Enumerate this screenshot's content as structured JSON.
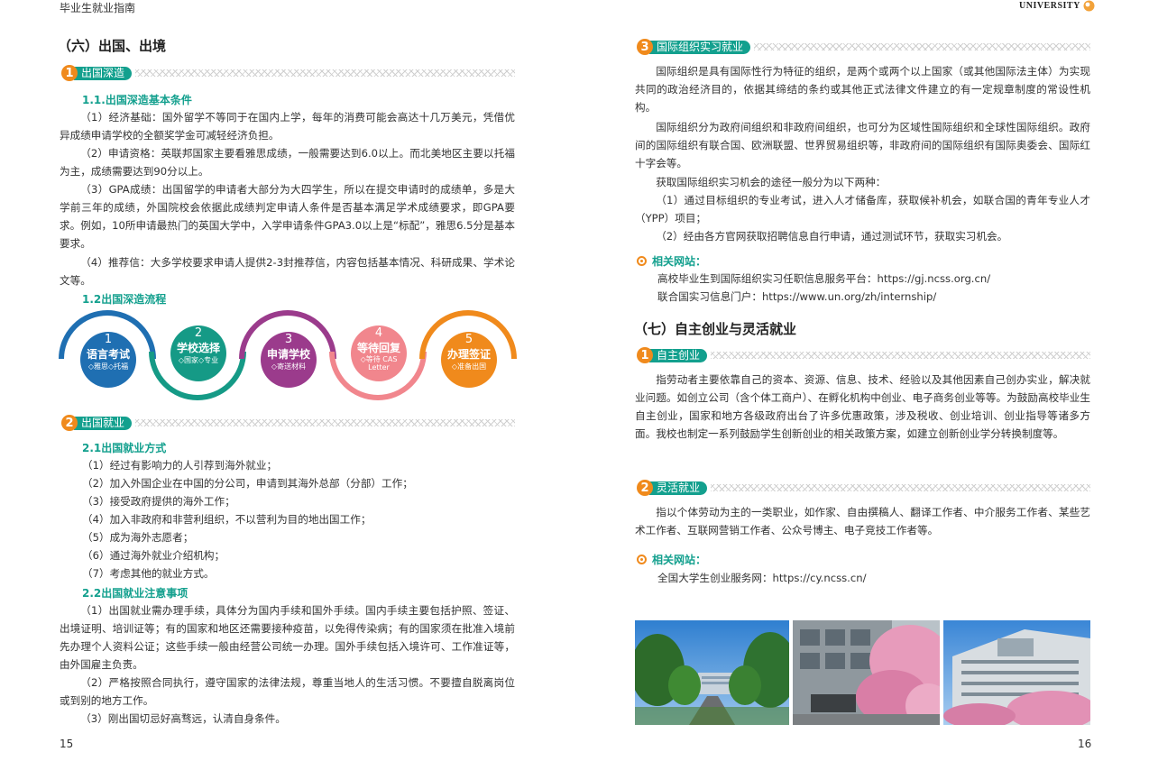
{
  "header": {
    "left_title": "毕业生就业指南",
    "right_brand": "UNIVERSITY"
  },
  "left": {
    "section_title": "（六）出国、出境",
    "badge1": {
      "num": "1",
      "label": "出国深造"
    },
    "sub_1_1": "1.1.出国深造基本条件",
    "p1": "（1）经济基础：国外留学不等同于在国内上学，每年的消费可能会高达十几万美元，凭借优异成绩申请学校的全额奖学金可减轻经济负担。",
    "p2": "（2）申请资格：英联邦国家主要看雅思成绩，一般需要达到6.0以上。而北美地区主要以托福为主，成绩需要达到90分以上。",
    "p3": "（3）GPA成绩：出国留学的申请者大部分为大四学生，所以在提交申请时的成绩单，多是大学前三年的成绩，外国院校会依据此成绩判定申请人条件是否基本满足学术成绩要求，即GPA要求。例如，10所申请最热门的英国大学中，入学申请条件GPA3.0以上是“标配”，雅思6.5分是基本要求。",
    "p4": "（4）推荐信：大多学校要求申请人提供2-3封推荐信，内容包括基本情况、科研成果、学术论文等。",
    "sub_1_2": "1.2出国深造流程",
    "steps": [
      {
        "num": "1",
        "title": "语言考试",
        "desc": "◇雅思◇托福",
        "color": "#1f6fb2"
      },
      {
        "num": "2",
        "title": "学校选择",
        "desc": "◇国家◇专业",
        "color": "#159a86"
      },
      {
        "num": "3",
        "title": "申请学校",
        "desc": "◇寄送材料",
        "color": "#9b3b8c"
      },
      {
        "num": "4",
        "title": "等待回复",
        "desc": "◇等待 CAS Letter",
        "color": "#f1868d"
      },
      {
        "num": "5",
        "title": "办理签证",
        "desc": "◇准备出国",
        "color": "#f08a1c"
      }
    ],
    "badge2": {
      "num": "2",
      "label": "出国就业"
    },
    "sub_2_1": "2.1出国就业方式",
    "ways": [
      "（1）经过有影响力的人引荐到海外就业；",
      "（2）加入外国企业在中国的分公司，申请到其海外总部（分部）工作；",
      "（3）接受政府提供的海外工作；",
      "（4）加入非政府和非营利组织，不以营利为目的地出国工作；",
      "（5）成为海外志愿者；",
      "（6）通过海外就业介绍机构；",
      "（7）考虑其他的就业方式。"
    ],
    "sub_2_2": "2.2出国就业注意事项",
    "n1": "（1）出国就业需办理手续，具体分为国内手续和国外手续。国内手续主要包括护照、签证、出境证明、培训证等；有的国家和地区还需要接种疫苗，以免得传染病；有的国家须在批准入境前先办理个人资料公证；这些手续一般由经营公司统一办理。国外手续包括入境许可、工作准证等，由外国雇主负责。",
    "n2": "（2）严格按照合同执行，遵守国家的法律法规，尊重当地人的生活习惯。不要擅自脱离岗位或到别的地方工作。",
    "n3": "（3）刚出国切忌好高骛远，认清自身条件。",
    "page_num": "15"
  },
  "right": {
    "badge3": {
      "num": "3",
      "label": "国际组织实习就业"
    },
    "r1": "国际组织是具有国际性行为特征的组织，是两个或两个以上国家（或其他国际法主体）为实现共同的政治经济目的，依据其缔结的条约或其他正式法律文件建立的有一定规章制度的常设性机构。",
    "r2": "国际组织分为政府间组织和非政府间组织，也可分为区域性国际组织和全球性国际组织。政府间的国际组织有联合国、欧洲联盟、世界贸易组织等，非政府间的国际组织有国际奥委会、国际红十字会等。",
    "r3": "获取国际组织实习机会的途径一般分为以下两种：",
    "r4": "（1）通过目标组织的专业考试，进入人才储备库，获取候补机会，如联合国的青年专业人才（YPP）项目；",
    "r5": "（2）经由各方官网获取招聘信息自行申请，通过测试环节，获取实习机会。",
    "site_label": "相关网站：",
    "site1": "高校毕业生到国际组织实习任职信息服务平台：https://gj.ncss.org.cn/",
    "site2": "联合国实习信息门户：https://www.un.org/zh/internship/",
    "section_title": "（七）自主创业与灵活就业",
    "badge4": {
      "num": "1",
      "label": "自主创业"
    },
    "e1": "指劳动者主要依靠自己的资本、资源、信息、技术、经验以及其他因素自己创办实业，解决就业问题。如创立公司（含个体工商户）、在孵化机构中创业、电子商务创业等等。为鼓励高校毕业生自主创业，国家和地方各级政府出台了许多优惠政策，涉及税收、创业培训、创业指导等诸多方面。我校也制定一系列鼓励学生创新创业的相关政策方案，如建立创新创业学分转换制度等。",
    "badge5": {
      "num": "2",
      "label": "灵活就业"
    },
    "f1": "指以个体劳动为主的一类职业，如作家、自由撰稿人、翻译工作者、中介服务工作者、某些艺术工作者、互联网营销工作者、公众号博主、电子竞技工作者等。",
    "site3": "全国大学生创业服务网：https://cy.ncss.cn/",
    "page_num": "16"
  }
}
